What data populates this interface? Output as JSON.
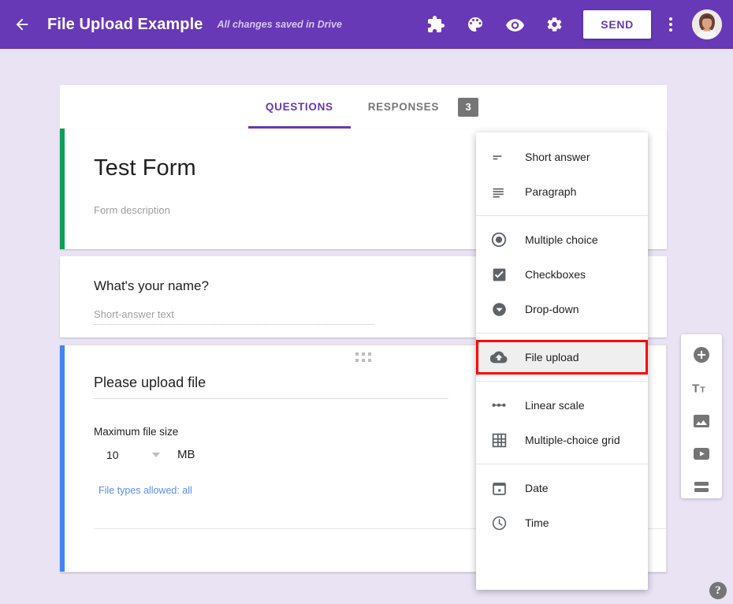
{
  "header": {
    "back_icon": "arrow-back-icon",
    "title": "File Upload Example",
    "save_status": "All changes saved in Drive",
    "icons": [
      {
        "name": "puzzle-addons-icon",
        "label": "Add-ons"
      },
      {
        "name": "palette-theme-icon",
        "label": "Theme"
      },
      {
        "name": "eye-preview-icon",
        "label": "Preview"
      },
      {
        "name": "gear-settings-icon",
        "label": "Settings"
      }
    ],
    "send_label": "SEND",
    "more_label": "More options",
    "avatar_label": "Account"
  },
  "tabs": [
    {
      "label": "QUESTIONS",
      "active": true
    },
    {
      "label": "RESPONSES",
      "active": false
    }
  ],
  "responses_badge": "3",
  "form": {
    "title": "Test Form",
    "description": "Form description",
    "accent_title_card": "#0F9D58",
    "accent_active_card": "#4285F4"
  },
  "question_name": {
    "title": "What's your name?",
    "answer_placeholder": "Short-answer text"
  },
  "question_upload": {
    "title": "Please upload file",
    "image_button": "insert-image-icon",
    "max_size_label": "Maximum file size",
    "max_size_value": "10",
    "max_size_unit": "MB",
    "file_types": "File types allowed: all",
    "footer": {
      "duplicate": "duplicate-icon",
      "more": "more-options-icon"
    }
  },
  "side_toolbar": [
    {
      "name": "add-question-button",
      "icon": "plus-circle-icon"
    },
    {
      "name": "add-title-button",
      "icon": "title-text-icon"
    },
    {
      "name": "add-image-button",
      "icon": "image-icon"
    },
    {
      "name": "add-video-button",
      "icon": "video-play-icon"
    },
    {
      "name": "add-section-button",
      "icon": "section-split-icon"
    }
  ],
  "question_type_menu": {
    "groups": [
      {
        "items": [
          {
            "label": "Short answer",
            "icon": "short-answer-icon",
            "highlighted": false
          },
          {
            "label": "Paragraph",
            "icon": "paragraph-icon",
            "highlighted": false
          }
        ]
      },
      {
        "items": [
          {
            "label": "Multiple choice",
            "icon": "radio-button-icon",
            "highlighted": false
          },
          {
            "label": "Checkboxes",
            "icon": "checkbox-icon",
            "highlighted": false
          },
          {
            "label": "Drop-down",
            "icon": "dropdown-circle-icon",
            "highlighted": false
          }
        ]
      },
      {
        "items": [
          {
            "label": "File upload",
            "icon": "cloud-upload-icon",
            "highlighted": true
          }
        ]
      },
      {
        "items": [
          {
            "label": "Linear scale",
            "icon": "linear-scale-icon",
            "highlighted": false
          },
          {
            "label": "Multiple-choice grid",
            "icon": "grid-icon",
            "highlighted": false
          }
        ]
      },
      {
        "items": [
          {
            "label": "Date",
            "icon": "calendar-icon",
            "highlighted": false
          },
          {
            "label": "Time",
            "icon": "clock-icon",
            "highlighted": false
          }
        ]
      }
    ],
    "highlight_color": "#FF0000"
  },
  "help": {
    "label": "?"
  },
  "colors": {
    "header_purple": "#6739B7",
    "page_background": "#E9E3F4",
    "link_blue": "#5B8DEF",
    "badge_gray": "#757575"
  }
}
